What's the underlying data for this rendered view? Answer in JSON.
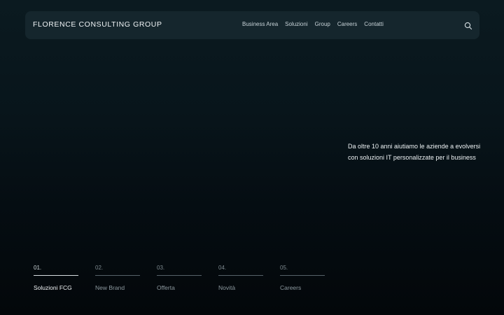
{
  "header": {
    "logo": "FLORENCE CONSULTING GROUP",
    "nav": [
      "Business Area",
      "Soluzioni",
      "Group",
      "Careers",
      "Contatti"
    ],
    "search_icon": "search-icon"
  },
  "hero": {
    "tagline": "Da oltre 10 anni aiutiamo le aziende a evolversi con soluzioni IT personalizzate per il business"
  },
  "steps": [
    {
      "num": "01.",
      "label": "Soluzioni FCG",
      "active": true
    },
    {
      "num": "02.",
      "label": "New Brand",
      "active": false
    },
    {
      "num": "03.",
      "label": "Offerta",
      "active": false
    },
    {
      "num": "04.",
      "label": "Novità",
      "active": false
    },
    {
      "num": "05.",
      "label": "Careers",
      "active": false
    }
  ],
  "colors": {
    "background": "#08151b",
    "navbar": "#15262d",
    "text": "#eef3f5"
  }
}
